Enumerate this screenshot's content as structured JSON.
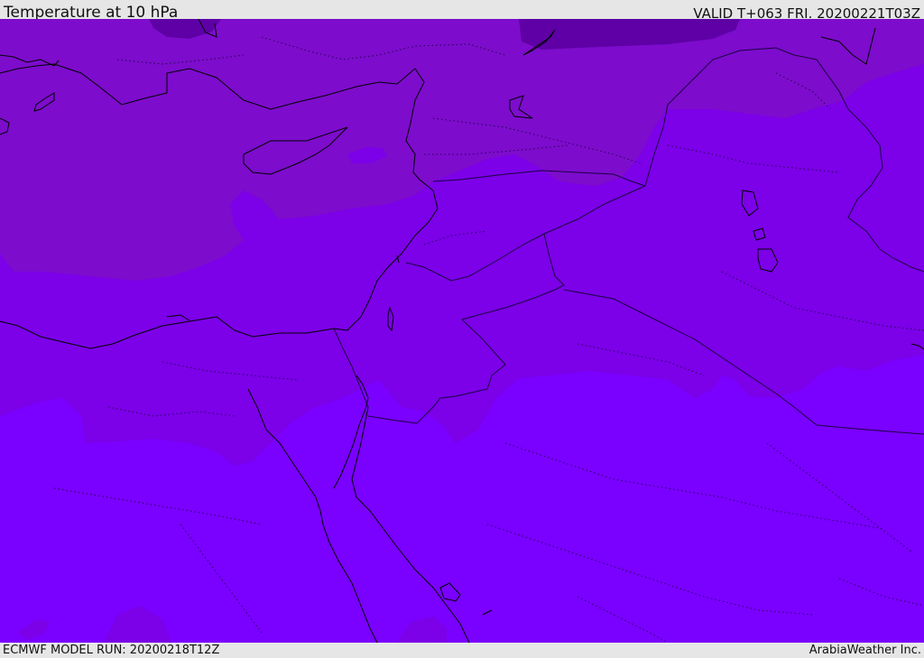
{
  "header": {
    "title": "Temperature at 10 hPa",
    "valid": "VALID T+063 FRI. 20200221T03Z"
  },
  "footer": {
    "model_run": "ECMWF MODEL RUN: 20200218T12Z",
    "credit": "ArabiaWeather Inc."
  },
  "map": {
    "field": "temperature-shading",
    "colors": {
      "coldest": "#5e00a6",
      "cold": "#6c0ab4",
      "mid": "#7d0ccc",
      "warm": "#7c00e8",
      "warmest": "#7a00ff",
      "coast": "#000000",
      "border": "#1a0040"
    }
  }
}
